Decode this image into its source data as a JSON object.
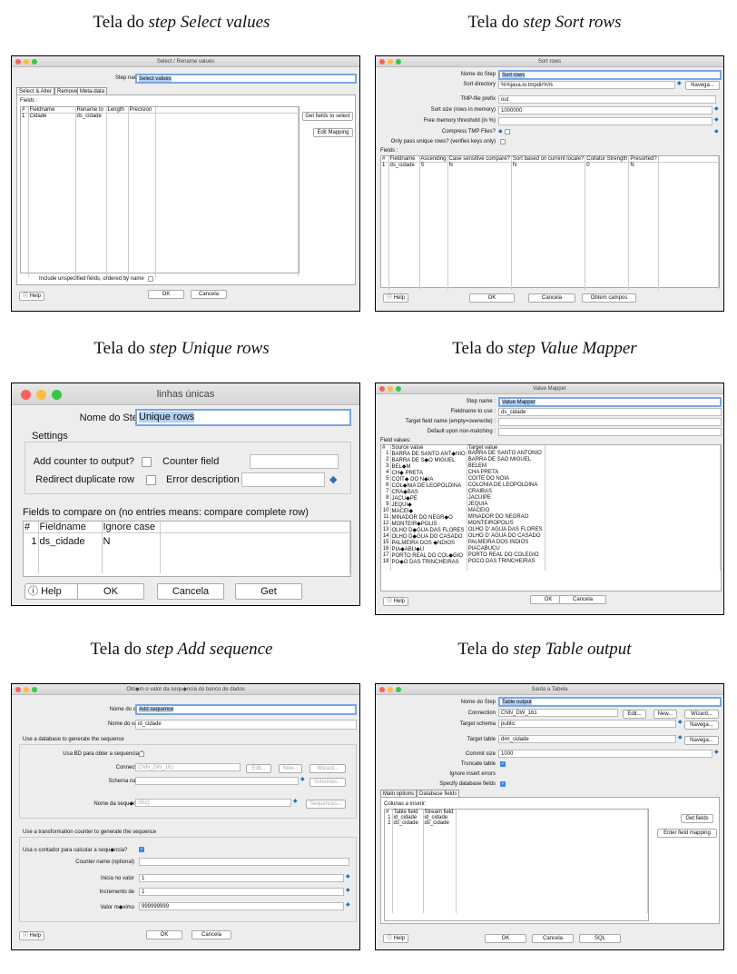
{
  "captions": {
    "c1": {
      "prefix": "Tela do ",
      "italic": "step Select values"
    },
    "c2": {
      "prefix": "Tela do ",
      "italic": "step Sort rows"
    },
    "c3": {
      "prefix": "Tela do ",
      "italic": "step Unique rows"
    },
    "c4": {
      "prefix": "Tela do ",
      "italic": "step Value Mapper"
    },
    "c5": {
      "prefix": "Tela do ",
      "italic": "step Add sequence"
    },
    "c6": {
      "prefix": "Tela do ",
      "italic": "step Table output"
    }
  },
  "select_values": {
    "title": "Select / Rename values",
    "step_name_label": "Step name",
    "step_name_value": "Select values",
    "tabs": [
      "Select & Alter",
      "Remove",
      "Meta-data"
    ],
    "fields_label": "Fields :",
    "headers": [
      "#",
      "Fieldname",
      "Rename to",
      "Length",
      "Precision"
    ],
    "row": [
      "1",
      "Cidade",
      "ds_cidade",
      "",
      ""
    ],
    "get_fields_btn": "Get fields to select",
    "edit_mapping_btn": "Edit Mapping",
    "include_label": "Include unspecified fields, ordered by name",
    "help": "Help",
    "ok": "OK",
    "cancel": "Cancela"
  },
  "sort_rows": {
    "title": "Sort rows",
    "step_label": "Nome do Step",
    "step_value": "Sort rows",
    "sortdir_label": "Sort directory",
    "sortdir_value": "%%java.io.tmpdir%%",
    "browse": "Navega...",
    "prefix_label": "TMP-file prefix",
    "prefix_value": "out",
    "size_label": "Sort size (rows in memory)",
    "size_value": "1000000",
    "freemem_label": "Free memory threshold (in %)",
    "compress_label": "Compress TMP Files?",
    "unique_label": "Only pass unique rows? (verifies keys only)",
    "fields_label": "Fields :",
    "headers": [
      "#",
      "Fieldname",
      "Ascending",
      "Case sensitive compare?",
      "Sort based on current locale?",
      "Collator Strength",
      "Presorted?"
    ],
    "row": [
      "1",
      "ds_cidade",
      "S",
      "N",
      "N",
      "0",
      "N"
    ],
    "help": "Help",
    "ok": "OK",
    "cancel": "Cancela",
    "get": "Obtem campos"
  },
  "unique_rows": {
    "title": "linhas únicas",
    "step_label": "Nome do Step",
    "step_value": "Unique rows",
    "settings": "Settings",
    "add_counter": "Add counter to output?",
    "counter_field": "Counter field",
    "redirect": "Redirect duplicate row",
    "error_desc": "Error description",
    "fields_label": "Fields to compare on (no entries means: compare complete row)",
    "headers": [
      "#",
      "Fieldname",
      "Ignore case"
    ],
    "row": [
      "1",
      "ds_cidade",
      "N"
    ],
    "help": "Help",
    "ok": "OK",
    "cancel": "Cancela",
    "get": "Get"
  },
  "value_mapper": {
    "title": "Value Mapper",
    "step_label": "Step name :",
    "step_value": "Value Mapper",
    "fieldname_label": "Fieldname to use :",
    "fieldname_value": "ds_cidade",
    "target_label": "Target field name (empty=overwrite) :",
    "default_label": "Default upon non-matching :",
    "fields_label": "Field values:",
    "headers": [
      "#",
      "Source value",
      "Target value"
    ],
    "rows": [
      [
        "1",
        "BARRA DE SANTO ANT◆NIO",
        "BARRA DE SANTO ANTONIO"
      ],
      [
        "2",
        "BARRA DE S◆O MIGUEL",
        "BARRA DE SAO MIGUEL"
      ],
      [
        "3",
        "BEL◆M",
        "BELEM"
      ],
      [
        "4",
        "CH◆ PRETA",
        "CHA PRETA"
      ],
      [
        "5",
        "COIT◆ DO N◆IA",
        "COITE DO NOIA"
      ],
      [
        "6",
        "COL◆NIA DE LEOPOLDINA",
        "COLONIA DE LEOPOLDINA"
      ],
      [
        "7",
        "CRA◆BAS",
        "CRAIBAS"
      ],
      [
        "8",
        "JACU◆PE",
        "JACUIPE"
      ],
      [
        "9",
        "JEQUI◆",
        "JEQUIA"
      ],
      [
        "10",
        "MACEI◆",
        "MACEIO"
      ],
      [
        "11",
        "MINADOR DO NEGR◆O",
        "MINADOR DO NEGRAO"
      ],
      [
        "12",
        "MONTEIR◆POLIS",
        "MONTEIROPOLIS"
      ],
      [
        "13",
        "OLHO D◆GUA DAS FLORES",
        "OLHO D' AGUA DAS FLORES"
      ],
      [
        "14",
        "OLHO D◆GUA DO CASADO",
        "OLHO D' AGUA DO CASADO"
      ],
      [
        "15",
        "PALMEIRA DOS ◆NDIOS",
        "PALMEIRA DOS INDIOS"
      ],
      [
        "16",
        "PIA◆ABU◆U",
        "PIACABUCU"
      ],
      [
        "17",
        "PORTO REAL DO COL◆GIO",
        "PORTO REAL DO COLEGIO"
      ],
      [
        "18",
        "PO◆O DAS TRINCHEIRAS",
        "POCO DAS TRINCHEIRAS"
      ]
    ],
    "help": "Help",
    "ok": "OK",
    "cancel": "Cancela"
  },
  "add_sequence": {
    "title": "Obt◆m o valor da sequ◆ncia do banco de dados",
    "step_label": "Nome do step",
    "step_value": "Add sequence",
    "valor_label": "Nome do valor",
    "valor_value": "id_cidade",
    "db_section": "Use a database to generate the sequence",
    "usa_bd": "Usa BD para obter a sequencia ?",
    "connection_label": "Connection",
    "connection_value": "CNN_DW_161",
    "edit": "Edit...",
    "new": "New...",
    "wizard": "Wizard...",
    "schema_label": "Schema name",
    "schemas": "Schemas...",
    "seq_label": "Nome da sequ◆ncia",
    "seq_value": "SEQ",
    "sequences": "Sequences...",
    "tr_section": "Use a transformation counter to generate the sequence",
    "usa_contador": "Usa o contador para calcular a sequ◆ncia?",
    "counter_name": "Counter name (optional)",
    "inicia_label": "Inicia no valor",
    "inicia_value": "1",
    "incremento_label": "Incremento de",
    "incremento_value": "1",
    "max_label": "Valor m◆ximo",
    "max_value": "999999999",
    "help": "Help",
    "ok": "OK",
    "cancel": "Cancela"
  },
  "table_output": {
    "title": "Saída a Tabela",
    "step_label": "Nome do Step",
    "step_value": "Table output",
    "connection_label": "Connection",
    "connection_value": "CNN_DW_161",
    "edit": "Edit...",
    "new": "New...",
    "wizard": "Wizard...",
    "schema_label": "Target schema",
    "schema_value": "public",
    "browse": "Navega...",
    "table_label": "Target table",
    "table_value": "dim_cidade",
    "commit_label": "Commit size",
    "commit_value": "1000",
    "truncate_label": "Truncate table",
    "ignore_label": "Ignore insert errors",
    "specify_label": "Specify database fields",
    "tabs": [
      "Main options",
      "Database fields"
    ],
    "cols_label": "Colunas a inserir:",
    "headers": [
      "#",
      "Table field",
      "Stream field"
    ],
    "rows": [
      [
        "1",
        "id_cidade",
        "id_cidade"
      ],
      [
        "2",
        "ds_cidade",
        "ds_cidade"
      ]
    ],
    "get_fields": "Get fields",
    "enter_mapping": "Enter field mapping",
    "help": "Help",
    "ok": "OK",
    "cancel": "Cancela",
    "sql": "SQL"
  }
}
